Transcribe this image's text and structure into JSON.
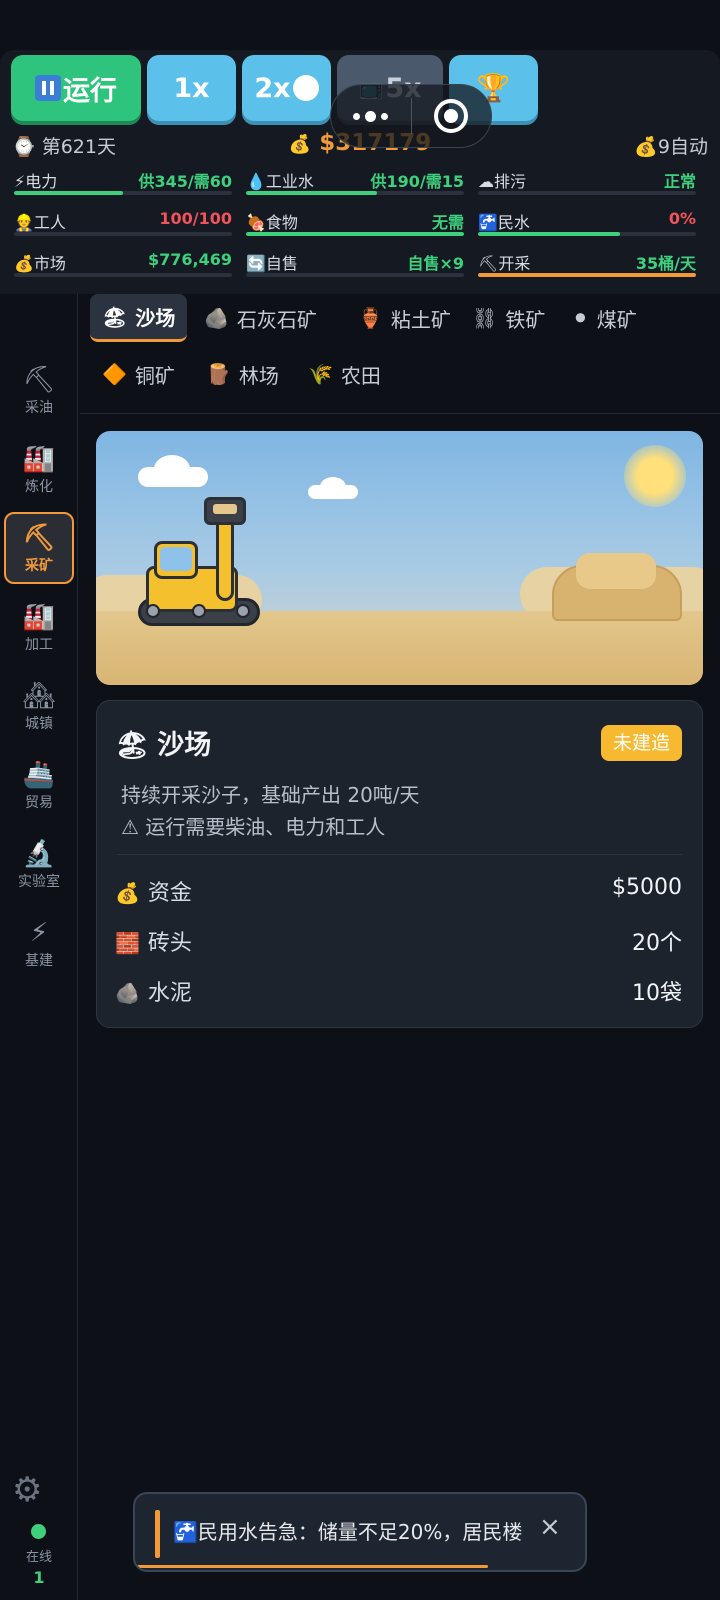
{
  "toolbar": {
    "run_label": "运行",
    "speeds": [
      "1x",
      "2x",
      "5x"
    ],
    "trophy_icon": "trophy-icon"
  },
  "status": {
    "day": "第621天",
    "money": "$317179",
    "auto": "9自动"
  },
  "stats": [
    {
      "icon": "⚡",
      "label": "电力",
      "value": "供345/需60",
      "color": "green",
      "fill_pct": 50
    },
    {
      "icon": "💧",
      "label": "工业水",
      "value": "供190/需15",
      "color": "green",
      "fill_pct": 60
    },
    {
      "icon": "☁",
      "label": "排污",
      "value": "正常",
      "color": "green",
      "fill_pct": 0
    },
    {
      "icon": "👷",
      "label": "工人",
      "value": "100/100",
      "color": "red",
      "fill_pct": 0
    },
    {
      "icon": "🍖",
      "label": "食物",
      "value": "无需",
      "color": "green",
      "fill_pct": 100
    },
    {
      "icon": "🚰",
      "label": "民水",
      "value": "0%",
      "color": "red",
      "fill_pct": 65
    },
    {
      "icon": "💰",
      "label": "市场",
      "value": "$776,469",
      "color": "green",
      "fill_pct": 0
    },
    {
      "icon": "🔄",
      "label": "自售",
      "value": "自售×9",
      "color": "green",
      "fill_pct": 0
    },
    {
      "icon": "⛏",
      "label": "开采",
      "value": "35桶/天",
      "color": "green",
      "fill_pct": 100
    }
  ],
  "sidebar": {
    "items": [
      {
        "icon": "⛏",
        "label": "采油"
      },
      {
        "icon": "🏭",
        "label": "炼化"
      },
      {
        "icon": "⛏",
        "label": "采矿"
      },
      {
        "icon": "🏭",
        "label": "加工"
      },
      {
        "icon": "🏘",
        "label": "城镇"
      },
      {
        "icon": "🚢",
        "label": "贸易"
      },
      {
        "icon": "🔬",
        "label": "实验室"
      },
      {
        "icon": "⚡",
        "label": "基建"
      }
    ],
    "online_label": "在线",
    "online_count": "1"
  },
  "tabs": [
    {
      "icon": "🏖",
      "label": "沙场"
    },
    {
      "icon": "🪨",
      "label": "石灰石矿"
    },
    {
      "icon": "🏺",
      "label": "粘土矿"
    },
    {
      "icon": "⛓",
      "label": "铁矿"
    },
    {
      "icon": "⚫",
      "label": "煤矿"
    },
    {
      "icon": "🔶",
      "label": "铜矿"
    },
    {
      "icon": "🪵",
      "label": "林场"
    },
    {
      "icon": "🌾",
      "label": "农田"
    }
  ],
  "card": {
    "icon": "🏖",
    "title": "沙场",
    "badge": "未建造",
    "desc": "持续开采沙子，基础产出 20吨/天",
    "warning": "⚠ 运行需要柴油、电力和工人",
    "resources": [
      {
        "icon": "💰",
        "name": "资金",
        "value": "$5000"
      },
      {
        "icon": "🧱",
        "name": "砖头",
        "value": "20个"
      },
      {
        "icon": "🪨",
        "name": "水泥",
        "value": "10袋"
      }
    ]
  },
  "toast": {
    "icon": "🚰",
    "message": "民用水告急：储量不足20%，居民楼",
    "close": "×",
    "progress_pct": 78
  }
}
